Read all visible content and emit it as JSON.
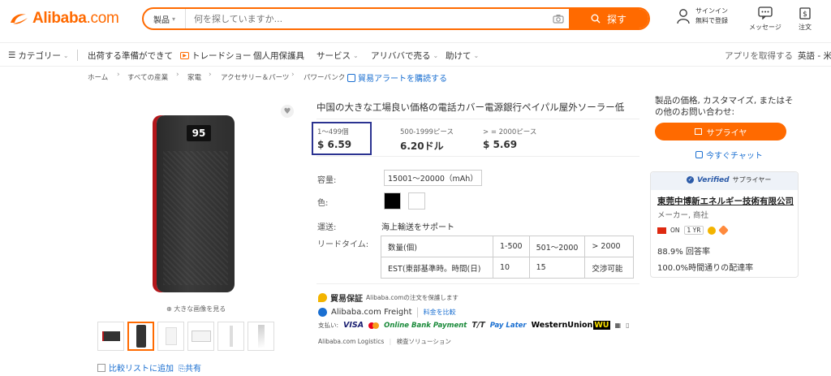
{
  "header": {
    "logo_text": "Alibaba",
    "logo_suffix": ".com",
    "search_category": "製品",
    "search_placeholder": "何を探していますか...",
    "search_button": "探す",
    "signin_line1": "サインイン",
    "signin_line2": "無料で登録",
    "messages": "メッセージ",
    "orders": "注文"
  },
  "nav": {
    "categories": "カテゴリー",
    "items": [
      "出荷する準備ができて",
      "トレードショー",
      "個人用保護具",
      "サービス",
      "アリババで売る",
      "助けて"
    ],
    "get_app": "アプリを取得する",
    "language": "英語 - 米"
  },
  "breadcrumb": [
    "ホーム",
    "すべての産業",
    "家電",
    "アクセサリー＆パーツ",
    "パワーバンク"
  ],
  "breadcrumb_alert": "貿易アラートを購読する",
  "gallery": {
    "screen_text": "95",
    "zoom_hint": "大きな画像を見る",
    "compare": "比較リストに追加",
    "share": "共有"
  },
  "product": {
    "title": "中国の大きな工場良い価格の電話カバー電源銀行ペイパル屋外ソーラー低",
    "tiers": [
      {
        "qty": "1～499個",
        "price": "$ 6.59"
      },
      {
        "qty": "500-1999ピース",
        "price": "6.20ドル"
      },
      {
        "qty": "> = 2000ピース",
        "price": "$ 5.69"
      }
    ],
    "capacity_label": "容量:",
    "capacity_value": "15001～20000（mAh）",
    "color_label": "色:",
    "colors": [
      "#000000",
      "#ffffff"
    ],
    "shipping_label": "運送:",
    "shipping_value": "海上輸送をサポート",
    "lead_label": "リードタイム:",
    "lead_table": {
      "row1": [
        "数量(個)",
        "1-500",
        "501～2000",
        "> 2000"
      ],
      "row2": [
        "EST(東部基準時。時間(日)",
        "10",
        "15",
        "交渉可能"
      ]
    },
    "trade_title": "貿易保証",
    "trade_desc": "Alibaba.comの注文を保護します",
    "freight_name": "Alibaba.com Freight",
    "freight_link": "料金を比較",
    "pay_label": "支払い:",
    "pay_methods": [
      "VISA",
      "Online Bank Payment",
      "T/T",
      "Pay Later",
      "WesternUnion",
      "WU"
    ],
    "logistics": [
      "Alibaba.com Logistics",
      "検査ソリューション"
    ]
  },
  "sidebar": {
    "request_text": "製品の価格, カスタマイズ, またはその他のお問い合わせ:",
    "supplier_button": "サプライヤ",
    "chat_link": "今すぐチャット",
    "verified": "Verified",
    "verified_suffix": "サプライヤー",
    "company": "東莞中博新エネルギー技術有限公司",
    "company_type": "メーカー, 商社",
    "on_badge": "ON",
    "year_badge": "1 YR",
    "response_rate": "88.9% 回答率",
    "on_time_rate": "100.0%時間通りの配達率"
  },
  "colors": {
    "brand": "#ff6a00",
    "link": "#1a6fd1",
    "highlight_box": "#2b3391"
  }
}
